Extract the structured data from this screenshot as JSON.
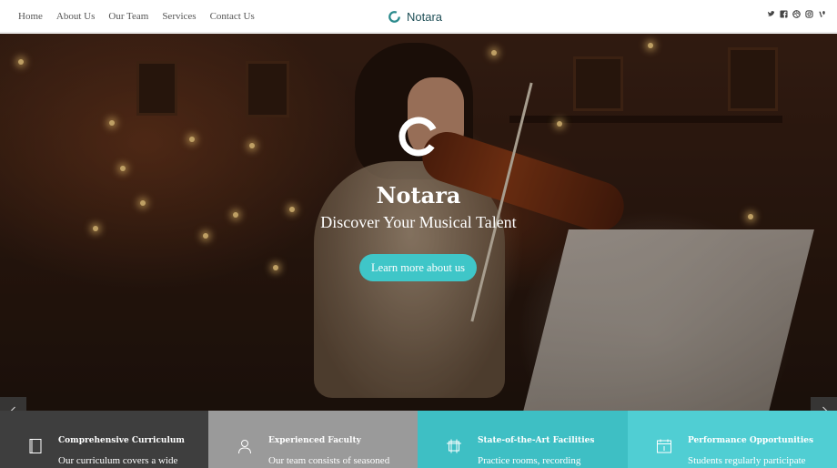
{
  "header": {
    "nav": [
      "Home",
      "About Us",
      "Our Team",
      "Services",
      "Contact Us"
    ],
    "brand": "Notara",
    "social_icons": [
      "twitter-icon",
      "facebook-icon",
      "dribbble-icon",
      "instagram-icon",
      "vine-icon"
    ]
  },
  "hero": {
    "title": "Notara",
    "subtitle": "Discover Your Musical Talent",
    "button_label": "Learn more about us"
  },
  "features": [
    {
      "icon": "book-icon",
      "title": "Comprehensive Curriculum",
      "text": "Our curriculum covers a wide"
    },
    {
      "icon": "user-icon",
      "title": "Experienced Faculty",
      "text": "Our team consists of seasoned"
    },
    {
      "icon": "building-icon",
      "title": "State-of-the-Art Facilities",
      "text": "Practice rooms, recording"
    },
    {
      "icon": "calendar-icon",
      "title": "Performance Opportunities",
      "text": "Students regularly participate"
    }
  ],
  "colors": {
    "accent": "#3fc6c8",
    "brand": "#1f4f57",
    "feature_backgrounds": [
      "#3e3e3e",
      "#9a9a9a",
      "#3ebfc4",
      "#50ced3"
    ]
  }
}
